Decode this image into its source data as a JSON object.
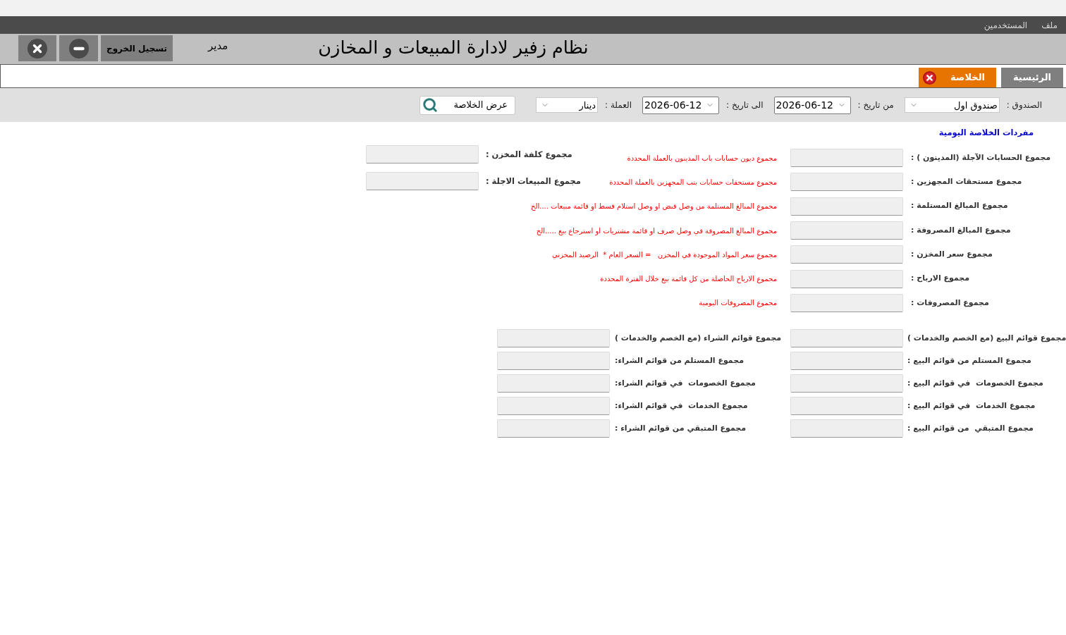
{
  "menu_bar": {
    "items": [
      "ملف",
      "المستخدمين"
    ]
  },
  "header": {
    "title": "نظام زفير لادارة المبيعات و المخازن",
    "user": "مدير",
    "logout_button": "تسجيل الخروج"
  },
  "tabs": [
    {
      "label": "الرئيسية",
      "selected": false,
      "closable": false
    },
    {
      "label": "الخلاصة",
      "selected": true,
      "closable": true
    }
  ],
  "filters": [
    {
      "kind": "select",
      "label": "الصندوق :",
      "value": "صندوق اول"
    },
    {
      "kind": "date",
      "label": "من تاريخ :",
      "value": "2026-06-12"
    },
    {
      "kind": "date",
      "label": "الى تاريخ :",
      "value": "2026-06-12"
    },
    {
      "kind": "select",
      "label": "العملة :",
      "value": "دينار"
    }
  ],
  "show_button": "عرض الخلاصة",
  "section_title": "مفردات الخلاصة اليومية",
  "daily_totals": [
    {
      "label": "مجموع الحسابات الآجلة (المدينون ) :",
      "note": "مجموع ديون حسابات باب المدينون بالعملة المحددة"
    },
    {
      "label": "مجموع مستحقات المجهزين :",
      "note": "مجموع مستحقات حسابات بتب المجهزين بالعملة المحددة"
    },
    {
      "label": "مجموع المبالغ المستلمة :",
      "note": "مجموع المبالغ المستلمة من وصل قبض او وصل استلام قسط او قائمة مبيعات ....الخ"
    },
    {
      "label": "مجموع المبالغ المصروفة :",
      "note": "مجموع المبالغ المصروفة في وصل صرف او قائمة مشتريات او استرجاع بيع .....الخ"
    },
    {
      "label": "مجموع سعر المخزن :",
      "note": "مجموع سعر المواد الموجودة في المخزن   = السعر العام *  الرصيد المخزني"
    },
    {
      "label": "مجموع الارباح :",
      "note": "مجموع الارباح الحاصلة من كل قائمة بيع خلال الفترة المحددة"
    },
    {
      "label": "مجموع المصروفات :",
      "note": "مجموع المصروفات اليومية"
    }
  ],
  "stock_totals": [
    "مجموع كلفة المخزن :",
    "مجموع المبيعات الاجلة :"
  ],
  "sales_totals": [
    "مجموع قوائم البيع (مع الخصم والخدمات )",
    "مجموع المستلم من قوائم البيع :",
    "مجموع الخصومات  في قوائم البيع :",
    "مجموع الخدمات  في قوائم البيع :",
    "مجموع المتبقي  من قوائم البيع :"
  ],
  "purchase_totals": [
    "مجموع قوائم الشراء (مع الخصم والخدمات )",
    "مجموع المستلم من قوائم الشراء:",
    "مجموع الخصومات  في قوائم الشراء:",
    "مجموع الخدمات  في قوائم الشراء:",
    "مجموع المتبقي من قوائم الشراء :"
  ]
}
